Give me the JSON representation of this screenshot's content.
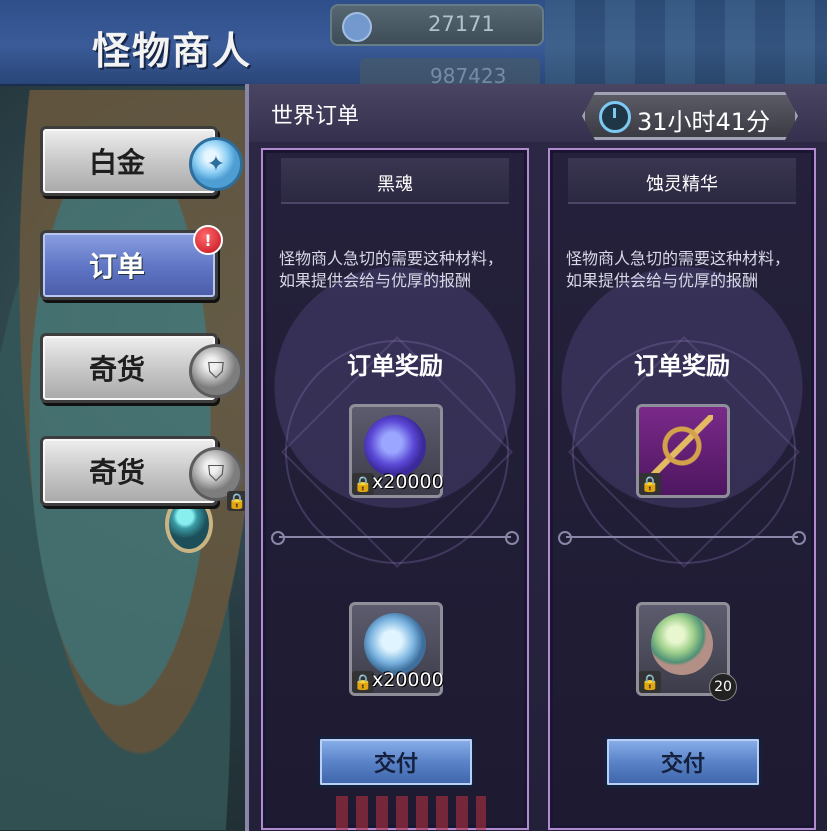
{
  "header": {
    "title": "怪物商人",
    "top_counter": "27171",
    "top_counter2": "987423"
  },
  "sidebar": {
    "items": [
      {
        "label": "白金",
        "icon": "platinum-coin-icon"
      },
      {
        "label": "订单",
        "icon": "alert-badge-icon",
        "active": true
      },
      {
        "label": "奇货",
        "icon": "silver-coin-icon"
      },
      {
        "label": "奇货",
        "icon": "silver-coin-icon",
        "locked": true
      }
    ]
  },
  "panel": {
    "title": "世界订单",
    "timer": "31小时41分"
  },
  "orders": [
    {
      "name": "黑魂",
      "description": "怪物商人急切的需要这种材料，如果提供会给与优厚的报酬",
      "reward_title": "订单奖励",
      "reward_qty": "x20000",
      "cost_qty": "x20000",
      "button": "交付"
    },
    {
      "name": "蚀灵精华",
      "description": "怪物商人急切的需要这种材料，如果提供会给与优厚的报酬",
      "reward_title": "订单奖励",
      "cost_count": "20",
      "button": "交付"
    }
  ],
  "colors": {
    "header_blue": "#3a5b98",
    "panel_purple": "#2d2845",
    "card_border": "#b18ad0",
    "button_blue": "#5a83c8"
  }
}
